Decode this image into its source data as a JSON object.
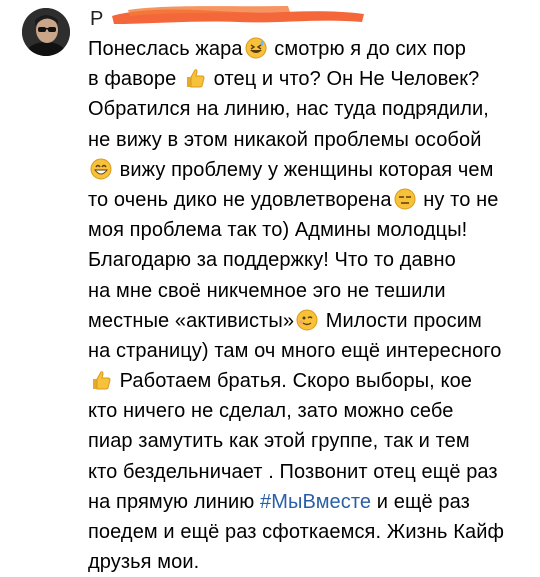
{
  "comment": {
    "author_initial": "Р",
    "lines": [
      {
        "parts": [
          {
            "t": "Понеслась жара"
          },
          {
            "emoji": "grin-sweat"
          },
          {
            "t": " смотрю я до сих пор"
          }
        ]
      },
      {
        "parts": [
          {
            "t": "в фаворе "
          },
          {
            "emoji": "thumbs-up"
          },
          {
            "t": " отец и что? Он Не Человек?"
          }
        ]
      },
      {
        "parts": [
          {
            "t": "Обратился на линию, нас туда подрядили,"
          }
        ]
      },
      {
        "parts": [
          {
            "t": "не вижу в этом никакой проблемы особой"
          }
        ]
      },
      {
        "parts": [
          {
            "emoji": "grin"
          },
          {
            "t": " вижу проблему у женщины которая чем"
          }
        ]
      },
      {
        "parts": [
          {
            "t": "то очень дико не удовлетворена"
          },
          {
            "emoji": "expressionless"
          },
          {
            "t": " ну то не"
          }
        ]
      },
      {
        "parts": [
          {
            "t": "моя проблема так то)  Админы молодцы!"
          }
        ]
      },
      {
        "parts": [
          {
            "t": "Благодарю за поддержку! Что то давно"
          }
        ]
      },
      {
        "parts": [
          {
            "t": "на мне своё никчемное эго не тешили"
          }
        ]
      },
      {
        "parts": [
          {
            "t": "местные «активисты»"
          },
          {
            "emoji": "wink"
          },
          {
            "t": " Милости просим"
          }
        ]
      },
      {
        "parts": [
          {
            "t": "на страницу) там оч много ещё интересного"
          }
        ]
      },
      {
        "parts": [
          {
            "emoji": "thumbs-up"
          },
          {
            "t": " Работаем братья. Скоро выборы, кое"
          }
        ]
      },
      {
        "parts": [
          {
            "t": "кто ничего не сделал, зато можно себе"
          }
        ]
      },
      {
        "parts": [
          {
            "t": "пиар замутить как этой группе, так и тем"
          }
        ]
      },
      {
        "parts": [
          {
            "t": "кто бездельничает . Позвонит отец ещё раз"
          }
        ]
      },
      {
        "parts": [
          {
            "t": "на прямую линию "
          },
          {
            "tag": "#МыВместе"
          },
          {
            "t": " и ещё раз"
          }
        ]
      },
      {
        "parts": [
          {
            "t": "поедем и ещё раз сфоткаемся. Жизнь Кайф"
          }
        ]
      },
      {
        "parts": [
          {
            "t": "друзья мои."
          }
        ]
      }
    ]
  },
  "colors": {
    "hashtag": "#2a5fa8",
    "redaction": "#f25a2a",
    "emoji_face": "#f7c23a",
    "text": "#000000"
  }
}
